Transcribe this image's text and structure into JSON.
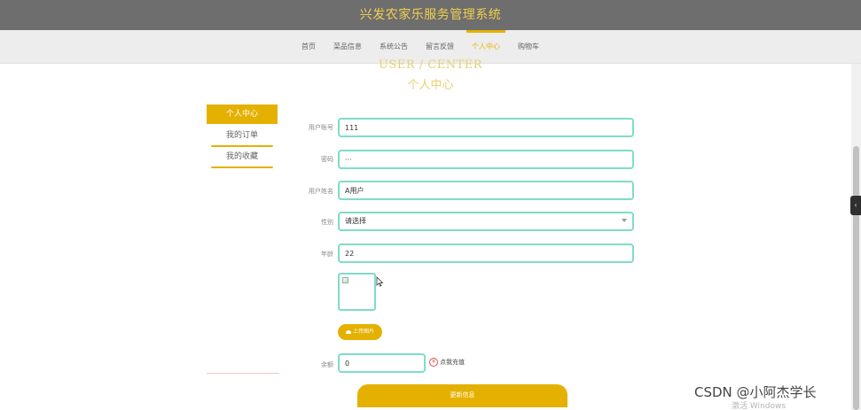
{
  "header": {
    "title": "兴发农家乐服务管理系统"
  },
  "nav": {
    "items": [
      {
        "label": "首页"
      },
      {
        "label": "菜品信息"
      },
      {
        "label": "系统公告"
      },
      {
        "label": "留言反馈"
      },
      {
        "label": "个人中心",
        "active": true
      },
      {
        "label": "购物车"
      }
    ]
  },
  "section": {
    "title_en": "USER / CENTER",
    "title_cn": "个人中心"
  },
  "sidebar": {
    "items": [
      {
        "label": "个人中心",
        "active": true
      },
      {
        "label": "我的订单"
      },
      {
        "label": "我的收藏"
      }
    ]
  },
  "form": {
    "account": {
      "label": "用户账号",
      "value": "111"
    },
    "password": {
      "label": "密码",
      "value": "···"
    },
    "name": {
      "label": "用户姓名",
      "value": "A用户"
    },
    "gender": {
      "label": "性别",
      "value": "请选择"
    },
    "age": {
      "label": "年龄",
      "value": "22"
    },
    "upload_label": "上传图片",
    "balance": {
      "label": "余额",
      "value": "0"
    },
    "recharge_icon": "¥",
    "recharge_label": "点我充值",
    "submit_label": "更新信息"
  },
  "colors": {
    "accent": "#e5b100",
    "header_bg": "#6e6e6e",
    "input_border": "#7fdcc8"
  },
  "overlay": {
    "watermark": "CSDN @小阿杰学长",
    "activate": "激活 Windows",
    "side_tab": "‹"
  }
}
